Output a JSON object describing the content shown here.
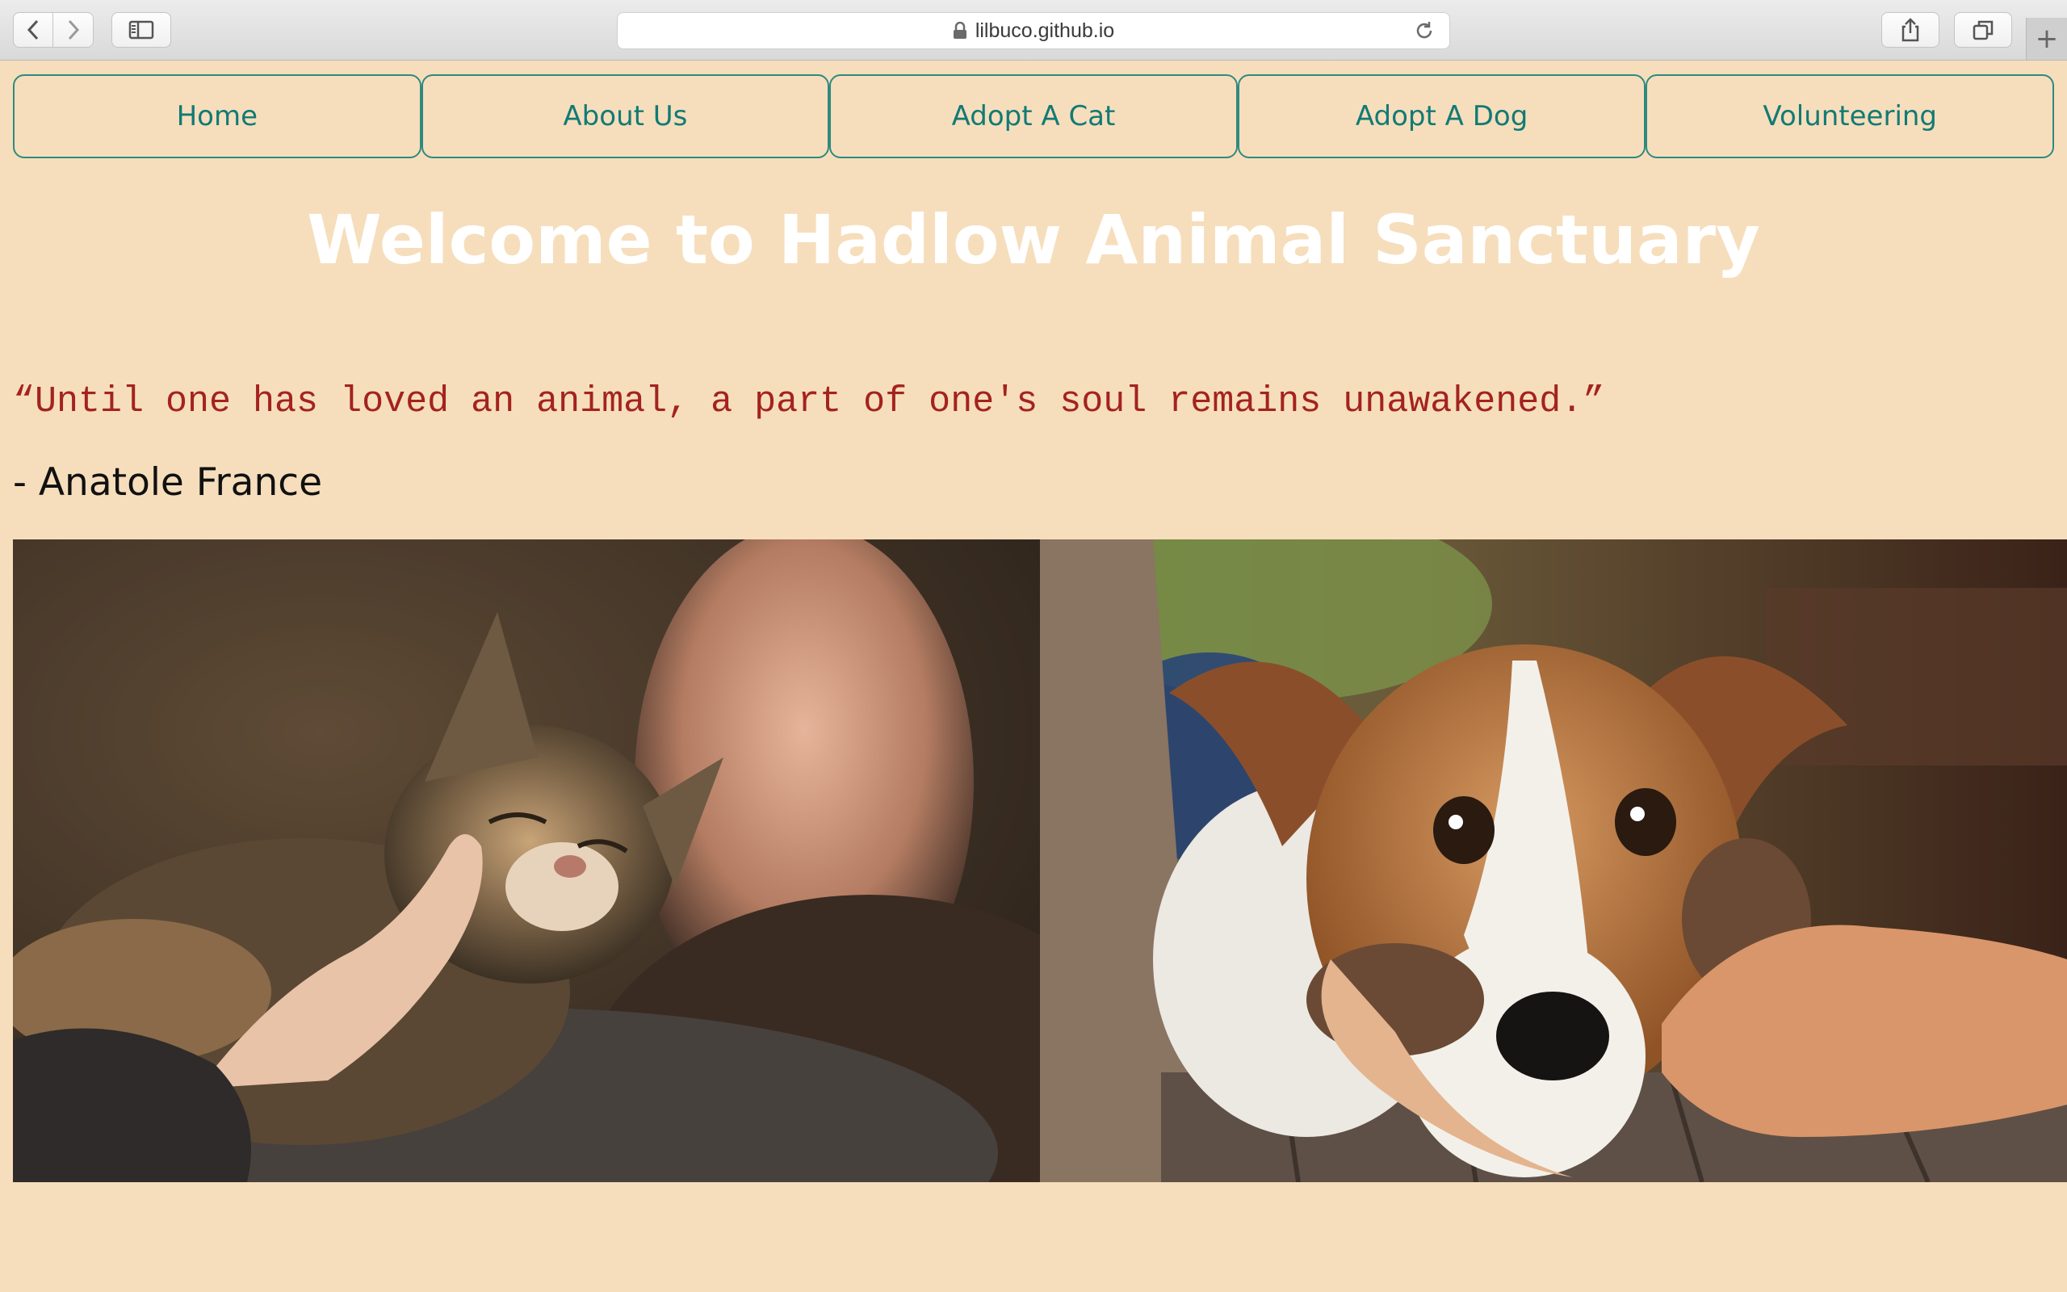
{
  "browser": {
    "url": "lilbuco.github.io",
    "icons": [
      "back-icon",
      "forward-icon",
      "sidebar-icon",
      "lock-icon",
      "reload-icon",
      "share-icon",
      "tabs-icon",
      "new-tab-icon"
    ]
  },
  "nav": {
    "items": [
      {
        "label": "Home"
      },
      {
        "label": "About Us"
      },
      {
        "label": "Adopt A Cat"
      },
      {
        "label": "Adopt A Dog"
      },
      {
        "label": "Volunteering"
      }
    ]
  },
  "main": {
    "title": "Welcome to Hadlow Animal Sanctuary",
    "quote": "“Until one has loved an animal, a part of one's soul remains unawakened.”",
    "author": "- Anatole France"
  },
  "colors": {
    "page_bg": "#f6debc",
    "nav_text": "#127a74",
    "nav_border": "#2f8a80",
    "quote_text": "#a3231f",
    "title_text": "#ffffff"
  }
}
